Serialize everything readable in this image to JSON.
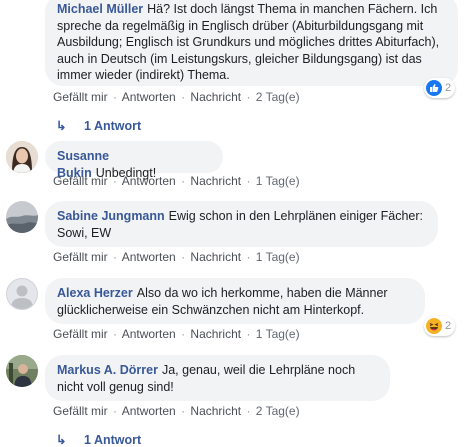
{
  "comments": [
    {
      "author": "Michael Müller",
      "text": "Hä? Ist doch längst Thema in manchen Fächern. Ich spreche da regelmäßig in Englisch drüber (Abiturbildungsgang mit Ausbildung; Englisch ist Grundkurs und mögliches drittes Abiturfach), auch in Deutsch (im Leistungskurs, gleicher Bildungsgang) ist das immer wieder (indirekt) Thema.",
      "like": "Gefällt mir",
      "reply": "Antworten",
      "message": "Nachricht",
      "time": "2 Tag(e)",
      "reaction_count": "2",
      "reaction_icon": "like-icon",
      "replies_label": "1 Antwort"
    },
    {
      "author": "Susanne Bukin",
      "text": "Unbedingt!",
      "like": "Gefällt mir",
      "reply": "Antworten",
      "message": "Nachricht",
      "time": "1 Tag(e)"
    },
    {
      "author": "Sabine Jungmann",
      "text": "Ewig schon in den Lehrplänen einiger Fächer: Sowi, EW",
      "like": "Gefällt mir",
      "reply": "Antworten",
      "message": "Nachricht",
      "time": "1 Tag(e)"
    },
    {
      "author": "Alexa Herzer",
      "text": "Also da wo ich herkomme, haben die Männer glücklicherweise ein Schwänzchen nicht am Hinterkopf.",
      "like": "Gefällt mir",
      "reply": "Antworten",
      "message": "Nachricht",
      "time": "1 Tag(e)",
      "reaction_count": "2",
      "reaction_icon": "haha-icon"
    },
    {
      "author": "Markus A. Dörrer",
      "text": "Ja, genau, weil die Lehrpläne noch nicht voll genug sind!",
      "like": "Gefällt mir",
      "reply": "Antworten",
      "message": "Nachricht",
      "time": "2 Tag(e)",
      "replies_label": "1 Antwort"
    }
  ],
  "separator": "·",
  "colors": {
    "author": "#385898",
    "bubble": "#f2f3f5",
    "like": "#1877f2",
    "haha": "#f7b125"
  }
}
